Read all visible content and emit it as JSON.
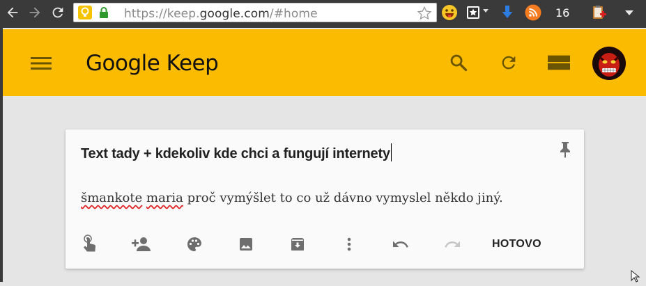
{
  "browser": {
    "url_prefix": "https://keep.",
    "url_domain": "google.com",
    "url_suffix": "/#home",
    "extension_count": "16"
  },
  "header": {
    "title": "Google Keep",
    "icons": [
      "menu-icon",
      "search-icon",
      "refresh-icon",
      "list-view-icon",
      "avatar"
    ],
    "background": "#fbbb00"
  },
  "note": {
    "title": "Text tady + kdekoliv kde chci a fungují internety",
    "body_misspelled_1": "šmankote",
    "body_space_1": " ",
    "body_misspelled_2": "maria",
    "body_rest": " proč vymýšlet to co už dávno vymyslel někdo jiný.",
    "toolbar": {
      "icons": [
        "reminder-icon",
        "collaborator-icon",
        "palette-icon",
        "image-icon",
        "archive-icon",
        "more-icon",
        "undo-icon",
        "redo-icon"
      ],
      "done_label": "HOTOVO"
    }
  }
}
